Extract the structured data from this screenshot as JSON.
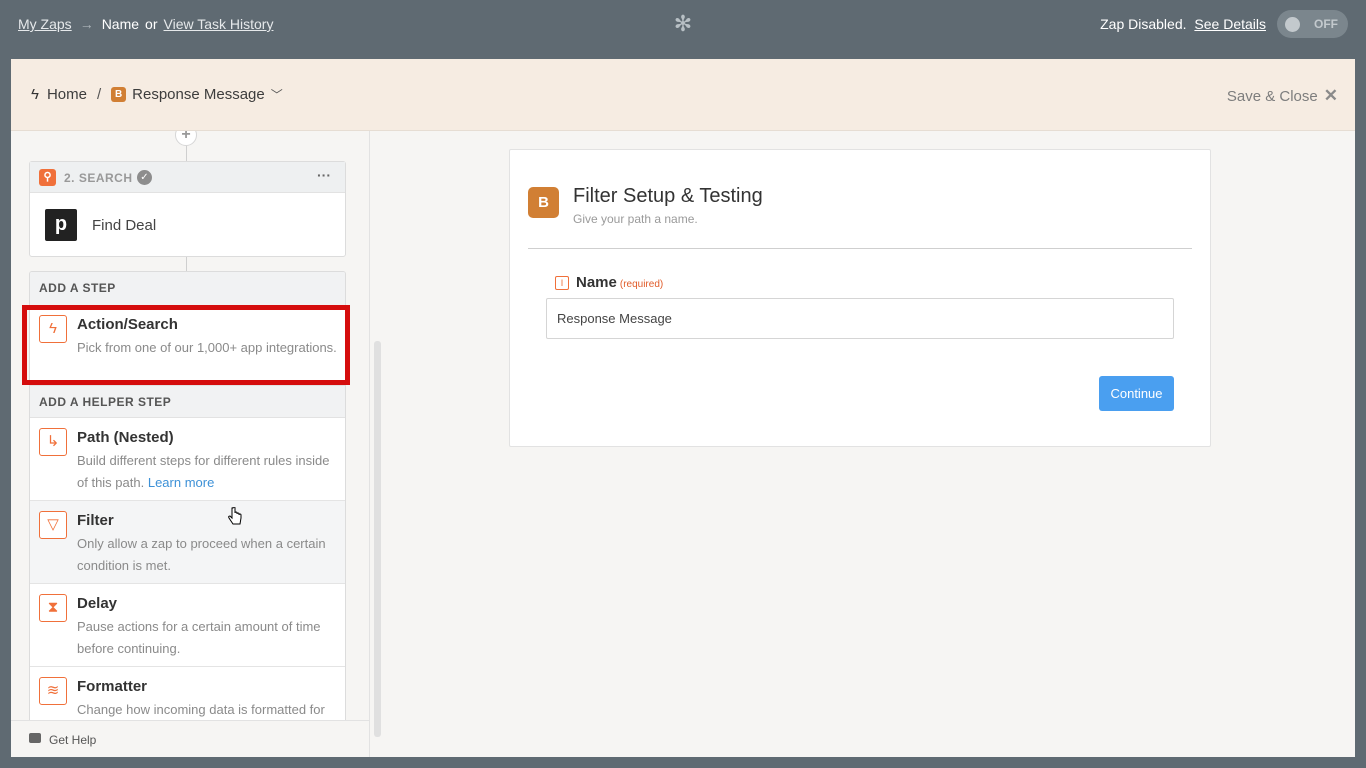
{
  "topbar": {
    "my_zaps": "My Zaps",
    "arrow": "→",
    "current": "Name",
    "or": "or",
    "view_task_history": "View Task History",
    "status_text": "Zap Disabled.",
    "see_details": "See Details",
    "toggle_label": "OFF"
  },
  "header": {
    "home": "Home",
    "separator": "/",
    "step_badge": "B",
    "step_name": "Response Message",
    "save_close": "Save & Close"
  },
  "sidebar": {
    "step": {
      "title": "2. SEARCH",
      "app_letter": "p",
      "app_name": "Find Deal"
    },
    "add_step_heading": "ADD A STEP",
    "helper_heading": "ADD A HELPER STEP",
    "items": [
      {
        "title": "Action/Search",
        "desc": "Pick from one of our 1,000+ app integrations.",
        "icon": "lightning-icon"
      },
      {
        "title": "Path (Nested)",
        "desc": "Build different steps for different rules inside of this path.",
        "link": "Learn more",
        "icon": "path-icon"
      },
      {
        "title": "Filter",
        "desc": "Only allow a zap to proceed when a certain condition is met.",
        "icon": "filter-icon"
      },
      {
        "title": "Delay",
        "desc": "Pause actions for a certain amount of time before continuing.",
        "icon": "hourglass-icon"
      },
      {
        "title": "Formatter",
        "desc": "Change how incoming data is formatted for",
        "icon": "formatter-icon"
      }
    ],
    "get_help": "Get Help"
  },
  "panel": {
    "badge": "B",
    "title": "Filter Setup & Testing",
    "subtitle": "Give your path a name.",
    "field_label": "Name",
    "field_required": "(required)",
    "field_value": "Response Message",
    "continue": "Continue"
  },
  "colors": {
    "topbar": "#5f6a72",
    "accent_orange": "#f0703a",
    "badge_orange": "#d17f34",
    "button_blue": "#4a9ff0",
    "highlight_red": "#d50d0d"
  }
}
